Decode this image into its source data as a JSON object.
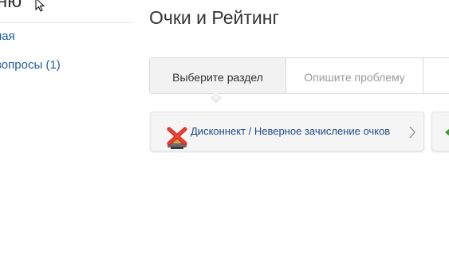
{
  "sidebar": {
    "title": "ню",
    "items": [
      {
        "label": "ная"
      },
      {
        "label": "вопросы (1)"
      }
    ]
  },
  "page": {
    "title": "Очки и Рейтинг"
  },
  "tabs": [
    {
      "label": "Выберите раздел",
      "active": true
    },
    {
      "label": "Опишите проблему",
      "active": false
    }
  ],
  "cards": [
    {
      "label": "Дисконнект / Неверное зачисление очков",
      "icon": "disconnect-x-icon"
    },
    {
      "label": "",
      "icon": "green-arrow-icon"
    }
  ],
  "colors": {
    "link": "#1f5d9c",
    "card_text": "#1f4b8a",
    "active_tab_bg": "#f2f2f2",
    "icon_red": "#d8261f",
    "icon_green": "#3a9a2a"
  }
}
